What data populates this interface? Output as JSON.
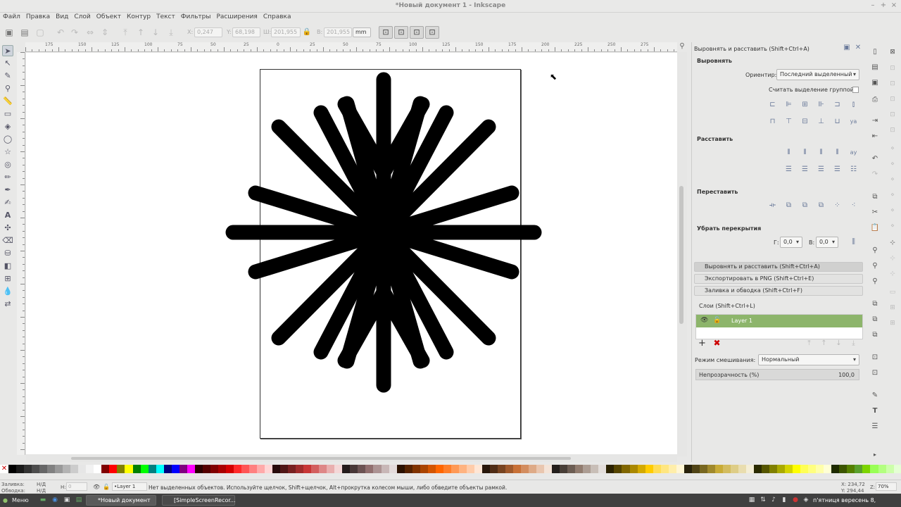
{
  "window": {
    "title": "*Новый документ 1 - Inkscape",
    "minimize": "–",
    "maximize": "+",
    "close": "×"
  },
  "menu": [
    "Файл",
    "Правка",
    "Вид",
    "Слой",
    "Объект",
    "Контур",
    "Текст",
    "Фильтры",
    "Расширения",
    "Справка"
  ],
  "toolcontrols": {
    "x_label": "X:",
    "x": "0,247",
    "y_label": "Y:",
    "y": "68,198",
    "w_label": "Ш:",
    "w": "201,955",
    "h_label": "В:",
    "h": "201,955",
    "unit": "mm"
  },
  "rulers": {
    "top_labels": [
      "175",
      "150",
      "125",
      "100",
      "75",
      "50",
      "25",
      "0",
      "25",
      "50",
      "75",
      "100",
      "125",
      "150",
      "175",
      "200",
      "225",
      "250",
      "275"
    ]
  },
  "dock": {
    "align_dialog_title": "Выровнять и расставить (Shift+Ctrl+A)",
    "align_section": "Выровнять",
    "relative_label": "Ориентир:",
    "relative_value": "Последний выделенный",
    "treat_group_label": "Считать выделение группой:",
    "distribute_section": "Расставить",
    "rearrange_section": "Переставить",
    "overlaps_section": "Убрать перекрытия",
    "h_gap_label": "Г:",
    "h_gap": "0,0",
    "v_gap_label": "В:",
    "v_gap": "0,0",
    "tabs": [
      "Выровнять и расставить (Shift+Ctrl+A)",
      "Экспортировать в PNG (Shift+Ctrl+E)",
      "Заливка и обводка (Shift+Ctrl+F)"
    ],
    "layers_title": "Слои (Shift+Ctrl+L)",
    "layer_name": "Layer 1",
    "blend_label": "Режим смешивания:",
    "blend_value": "Нормальный",
    "opacity_label": "Непрозрачность (%)",
    "opacity_value": "100,0"
  },
  "status": {
    "fill_label": "Заливка:",
    "fill_value": "Н/Д",
    "stroke_label": "Обводка:",
    "stroke_value": "Н/Д",
    "h_label": "Н:",
    "h_value": "0",
    "layer": "•Layer 1",
    "message": "Нет выделенных объектов. Используйте щелчок, Shift+щелчок, Alt+прокрутка колесом мыши, либо обведите объекты рамкой.",
    "cursor_x": "X: 234,72",
    "cursor_y": "Y: 294,44",
    "zoom_label": "Z:",
    "zoom": "70%"
  },
  "taskbar": {
    "menu": "Меню",
    "windows": [
      "*Новый документ ...",
      "[SimpleScreenRecor..."
    ],
    "clock": "п'ятниця вересень 8, 14:40:52"
  },
  "palette": [
    "#000000",
    "#1a1a1a",
    "#333333",
    "#4d4d4d",
    "#666666",
    "#808080",
    "#999999",
    "#b3b3b3",
    "#cccccc",
    "#e6e6e6",
    "#f2f2f2",
    "#ffffff",
    "#800000",
    "#ff0000",
    "#808000",
    "#ffff00",
    "#008000",
    "#00ff00",
    "#008080",
    "#00ffff",
    "#000080",
    "#0000ff",
    "#800080",
    "#ff00ff",
    "#2b0000",
    "#550000",
    "#800000",
    "#aa0000",
    "#d40000",
    "#ff2a2a",
    "#ff5555",
    "#ff8080",
    "#ffaaaa",
    "#ffd5d5",
    "#280b0b",
    "#501616",
    "#782121",
    "#a02c2c",
    "#c83737",
    "#d35f5f",
    "#de8787",
    "#e9afaf",
    "#f4d7d7",
    "#241c1c",
    "#483737",
    "#6c5353",
    "#916f6f",
    "#ac9393",
    "#c8b7b7",
    "#e3dbdb",
    "#2b1100",
    "#552200",
    "#803300",
    "#aa4400",
    "#d45500",
    "#ff6600",
    "#ff7f2a",
    "#ff9955",
    "#ffb380",
    "#ffccaa",
    "#ffe6d5",
    "#28170b",
    "#502d16",
    "#784421",
    "#a05a2c",
    "#c87137",
    "#d38d5f",
    "#deaa87",
    "#e9c6af",
    "#f4e3d7",
    "#241f1c",
    "#483e37",
    "#6c5d53",
    "#917c6f",
    "#ac9d93",
    "#c8beb7",
    "#e3dedb",
    "#2b2200",
    "#554400",
    "#806600",
    "#aa8800",
    "#d4aa00",
    "#ffcc00",
    "#ffdd55",
    "#ffe680",
    "#ffeeaa",
    "#fff6d5",
    "#28220b",
    "#504416",
    "#786721",
    "#a0892c",
    "#c8ab37",
    "#d3bc5f",
    "#decd87",
    "#e9ddaf",
    "#f4eed7",
    "#2b2b00",
    "#555500",
    "#808000",
    "#aaaa00",
    "#d4d400",
    "#ffff00",
    "#ffff55",
    "#ffff80",
    "#ffffaa",
    "#ffffd5",
    "#1e2b00",
    "#3c5500",
    "#558000",
    "#5aa02c",
    "#7cd400",
    "#99ff55",
    "#b3ff80",
    "#ccffaa",
    "#e5ffd5"
  ]
}
